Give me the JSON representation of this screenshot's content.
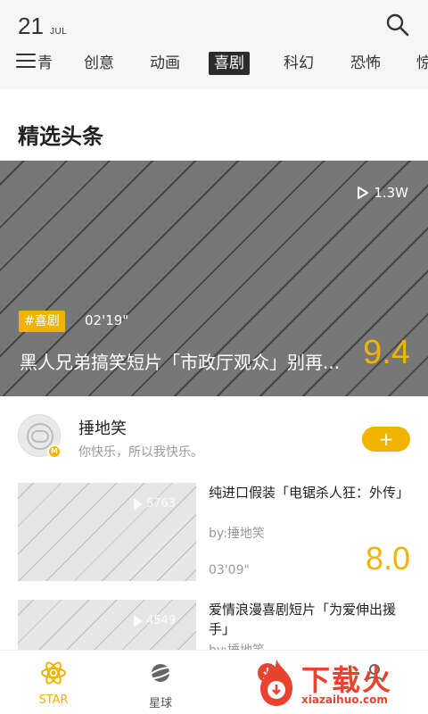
{
  "header": {
    "day": "21",
    "month": "JUL",
    "tabs": [
      {
        "label": "青"
      },
      {
        "label": "创意"
      },
      {
        "label": "动画"
      },
      {
        "label": "喜剧"
      },
      {
        "label": "科幻"
      },
      {
        "label": "恐怖"
      },
      {
        "label": "惊"
      }
    ],
    "active_tab": "喜剧"
  },
  "section": {
    "title": "精选头条"
  },
  "featured": {
    "plays": "1.3W",
    "tag": "#喜剧",
    "duration": "02'19\"",
    "title": "黑人兄弟搞笑短片「市政厅观众」别再...",
    "score": "9.4"
  },
  "channel": {
    "name": "捶地笑",
    "description": "你快乐，所以我快乐。",
    "badge": "M",
    "follow_label": "+"
  },
  "videos": [
    {
      "title": "纯进口假装「电锯杀人狂：外传」",
      "author": "by:捶地笑",
      "duration": "03'09\"",
      "score": "8.0",
      "plays": "5763"
    },
    {
      "title": "爱情浪漫喜剧短片「为爱伸出援手」",
      "author": "by:捶地笑",
      "duration": "",
      "score": "",
      "plays": "4549"
    }
  ],
  "bottom_nav": [
    {
      "label": "STAR",
      "icon": "atom-icon"
    },
    {
      "label": "星球",
      "icon": "planet-icon"
    },
    {
      "label": "",
      "icon": "download-icon"
    },
    {
      "label": "",
      "icon": "user-icon"
    }
  ],
  "watermark": {
    "text": "下载火",
    "sub": "xiazaihuo.com"
  },
  "colors": {
    "accent": "#f0b400",
    "watermark": "#e8432e"
  }
}
